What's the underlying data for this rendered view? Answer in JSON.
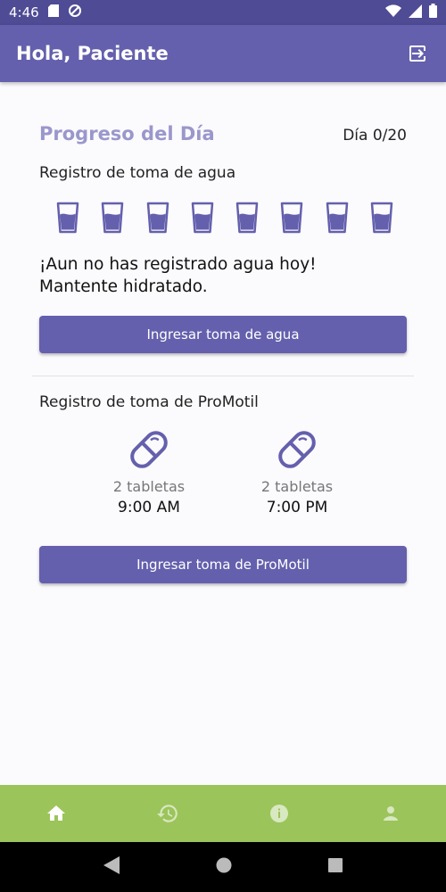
{
  "status_bar": {
    "time": "4:46"
  },
  "app_bar": {
    "title": "Hola, Paciente"
  },
  "progress": {
    "title": "Progreso del Día",
    "day_counter": "Día 0/20"
  },
  "water": {
    "label": "Registro de toma de agua",
    "glass_count": 8,
    "message_line1": "¡Aun no has registrado agua hoy!",
    "message_line2": "Mantente hidratado.",
    "button_label": "Ingresar toma de agua"
  },
  "promotil": {
    "label": "Registro de toma de ProMotil",
    "doses": [
      {
        "quantity": "2 tabletas",
        "time": "9:00 AM"
      },
      {
        "quantity": "2 tabletas",
        "time": "7:00 PM"
      }
    ],
    "button_label": "Ingresar toma de ProMotil"
  },
  "bottom_nav": {
    "items": [
      {
        "icon": "home-icon",
        "active": true
      },
      {
        "icon": "history-icon",
        "active": false
      },
      {
        "icon": "info-icon",
        "active": false
      },
      {
        "icon": "person-icon",
        "active": false
      }
    ]
  },
  "colors": {
    "primary": "#6460ad",
    "status_bar": "#4f4b94",
    "accent_title": "#9a97cc",
    "bottom_nav": "#9bc45a"
  }
}
